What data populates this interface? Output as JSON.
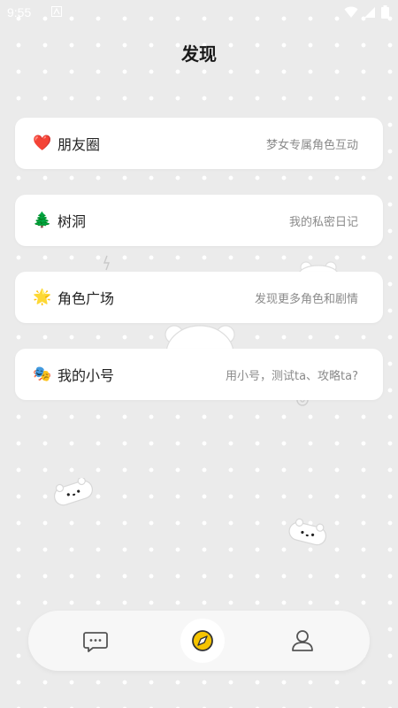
{
  "status_bar": {
    "time": "9:55"
  },
  "page": {
    "title": "发现"
  },
  "menu": [
    {
      "emoji": "❤️",
      "title": "朋友圈",
      "subtitle": "梦女专属角色互动"
    },
    {
      "emoji": "🌲",
      "title": "树洞",
      "subtitle": "我的私密日记"
    },
    {
      "emoji": "🌟",
      "title": "角色广场",
      "subtitle": "发现更多角色和剧情"
    },
    {
      "emoji": "🎭",
      "title": "我的小号",
      "subtitle": "用小号，测试ta、攻略ta?"
    }
  ],
  "nav": {
    "items": [
      {
        "icon": "chat-bubble-icon",
        "active": false
      },
      {
        "icon": "compass-icon",
        "active": true
      },
      {
        "icon": "profile-icon",
        "active": false
      }
    ],
    "accent": "#f5c400"
  }
}
